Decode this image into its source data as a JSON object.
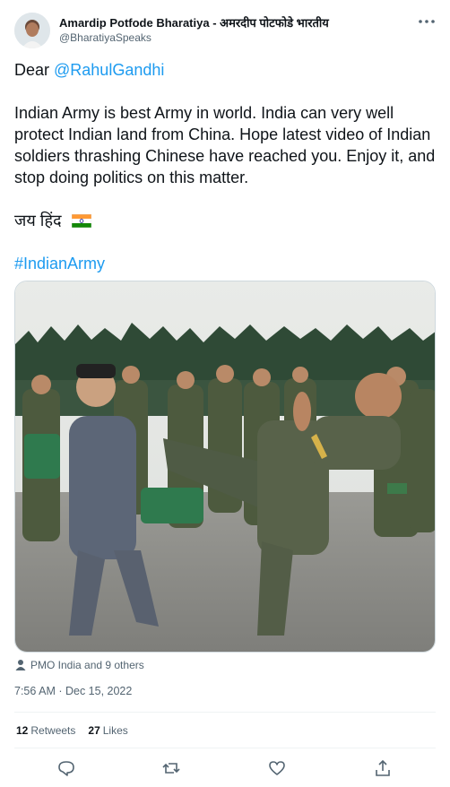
{
  "author": {
    "name": "Amardip Potfode Bharatiya - अमरदीप पोटफोडे भारतीय",
    "handle": "@BharatiyaSpeaks"
  },
  "tweet": {
    "greeting_prefix": "Dear ",
    "mention": "@RahulGandhi",
    "body": "Indian Army is best Army in world. India can very well protect Indian land from China. Hope latest video of Indian soldiers thrashing Chinese have reached you. Enjoy it, and stop doing politics on this matter.",
    "jai_hind": "जय हिंद",
    "flag_icon": "india-flag-icon",
    "hashtag": "#IndianArmy"
  },
  "media": {
    "tagged_text": "PMO India and 9 others"
  },
  "meta": {
    "timestamp": "7:56 AM · Dec 15, 2022"
  },
  "stats": {
    "retweets_count": "12",
    "retweets_label": "Retweets",
    "likes_count": "27",
    "likes_label": "Likes"
  },
  "actions": [
    "reply-icon",
    "retweet-icon",
    "like-icon",
    "share-icon"
  ],
  "colors": {
    "accent": "#1d9bf0",
    "text": "#0f1419",
    "secondary": "#536471"
  }
}
